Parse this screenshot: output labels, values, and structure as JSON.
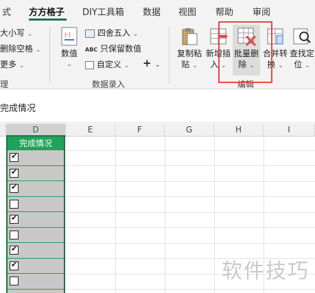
{
  "menu": {
    "tabs": [
      {
        "label": "式",
        "active": false
      },
      {
        "label": "方方格子",
        "active": true
      },
      {
        "label": "DIY工具箱",
        "active": false
      },
      {
        "label": "数据",
        "active": false
      },
      {
        "label": "视图",
        "active": false
      },
      {
        "label": "帮助",
        "active": false
      },
      {
        "label": "审阅",
        "active": false
      }
    ]
  },
  "ribbon": {
    "left_items": [
      "大小写",
      "删除空格",
      "更多"
    ],
    "left_group_label": "理",
    "number_btn": {
      "label": "数值"
    },
    "data_entry": {
      "items": [
        "四舍五入",
        "只保留数值",
        "自定义"
      ],
      "plus": "+",
      "group_label": "数据录入"
    },
    "buttons": [
      {
        "label1": "复制粘",
        "label2": "贴"
      },
      {
        "label1": "新增插",
        "label2": "入"
      },
      {
        "label1": "批量删",
        "label2": "除"
      },
      {
        "label1": "合并转",
        "label2": "换"
      },
      {
        "label1": "查找定",
        "label2": "位"
      }
    ],
    "edit_group_label": "编辑"
  },
  "formula": {
    "text": "完成情况"
  },
  "grid": {
    "columns": [
      "D",
      "E",
      "F",
      "G",
      "H",
      "I"
    ],
    "selected_column": "D",
    "header_cell": "完成情况",
    "checkboxes": [
      true,
      true,
      true,
      false,
      true,
      false,
      true,
      true,
      false
    ]
  },
  "watermark": "软件技巧",
  "colors": {
    "accent": "#1e7145",
    "header_green": "#1fa35a",
    "highlight": "#e04848"
  }
}
